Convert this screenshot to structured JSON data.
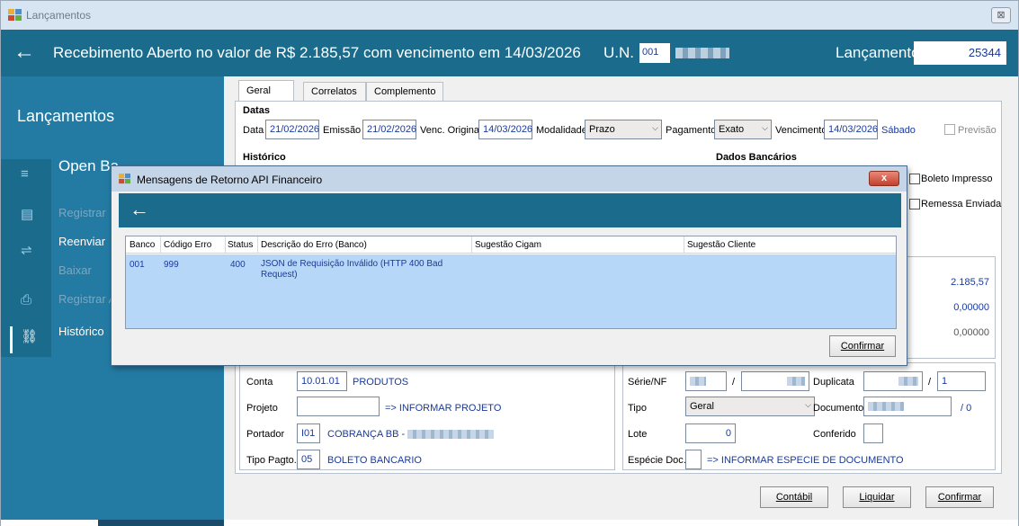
{
  "window": {
    "title": "Lançamentos",
    "close_label": "⊠"
  },
  "header": {
    "back_icon": "←",
    "message": "Recebimento Aberto no valor de R$ 2.185,57 com vencimento em 14/03/2026",
    "un_label": "U.N.",
    "un_code": "001",
    "lancamento_label": "Lançamento",
    "lancamento_value": "25344"
  },
  "sidebar": {
    "title": "Lançamentos",
    "group": "Open Ba",
    "items": [
      {
        "icon": "≡",
        "label": ""
      },
      {
        "icon": "▤",
        "label": "Registrar"
      },
      {
        "icon": "⇌",
        "label": "Reenviar"
      },
      {
        "icon": "",
        "label": "Baixar"
      },
      {
        "icon": "⎙",
        "label": "Registrar A"
      },
      {
        "icon": "⛓",
        "label": "Histórico"
      }
    ]
  },
  "tabs": [
    {
      "label": "Geral"
    },
    {
      "label": "Correlatos"
    },
    {
      "label": "Complemento"
    }
  ],
  "datas": {
    "section_label": "Datas",
    "data_label": "Data",
    "data_value": "21/02/2026",
    "emissao_label": "Emissão",
    "emissao_value": "21/02/2026",
    "venc_original_label": "Venc. Original",
    "venc_original_value": "14/03/2026",
    "modalidade_label": "Modalidade",
    "modalidade_value": "Prazo",
    "pagamento_label": "Pagamento",
    "pagamento_value": "Exato",
    "vencimento_label": "Vencimento",
    "vencimento_value": "14/03/2026",
    "dia_semana": "Sábado",
    "previsao_label": "Previsão"
  },
  "historico": {
    "section_label": "Histórico"
  },
  "dados_bancarios": {
    "section_label": "Dados Bancários",
    "boleto_impresso": "Boleto Impresso",
    "remessa_enviada": "Remessa Enviada"
  },
  "valores": {
    "valor1": "2.185,57",
    "valor2": "0,00000",
    "valor3": "0,00000"
  },
  "classificacao": {
    "conta_label": "Conta",
    "conta_value": "10.01.01",
    "conta_desc": "PRODUTOS",
    "projeto_label": "Projeto",
    "projeto_hint": "=> INFORMAR PROJETO",
    "portador_label": "Portador",
    "portador_value": "I01",
    "portador_desc": "COBRANÇA BB -",
    "tipo_pagto_label": "Tipo Pagto.",
    "tipo_pagto_value": "05",
    "tipo_pagto_desc": "BOLETO BANCARIO"
  },
  "documento": {
    "serie_label": "Série/NF",
    "slash": "/",
    "duplicata_label": "Duplicata",
    "duplicata_value": "1",
    "tipo_label": "Tipo",
    "tipo_value": "Geral",
    "documento_label": "Documento",
    "documento_suffix": "/ 0",
    "lote_label": "Lote",
    "lote_value": "0",
    "conferido_label": "Conferido",
    "especie_label": "Espécie Doc.",
    "especie_hint": "=> INFORMAR ESPECIE DE DOCUMENTO"
  },
  "buttons": {
    "contabil": "Contábil",
    "liquidar": "Liquidar",
    "confirmar": "Confirmar"
  },
  "dialog": {
    "title": "Mensagens de Retorno API Financeiro",
    "close_label": "x",
    "back_icon": "←",
    "columns": [
      "Banco",
      "Código Erro",
      "Status",
      "Descrição do Erro (Banco)",
      "Sugestão Cigam",
      "Sugestão Cliente"
    ],
    "rows": [
      {
        "banco": "001",
        "codigo": "999",
        "status": "400",
        "descricao": "JSON de Requisição Inválido (HTTP 400 Bad Request)",
        "sugestao_cigam": "",
        "sugestao_cliente": ""
      }
    ],
    "confirm_label": "Confirmar"
  },
  "colors": {
    "header_bg": "#1b6b8c",
    "sidebar_bg": "#237ba4",
    "selected_row": "#b7d7f8",
    "value_text": "#1a3a9a"
  }
}
